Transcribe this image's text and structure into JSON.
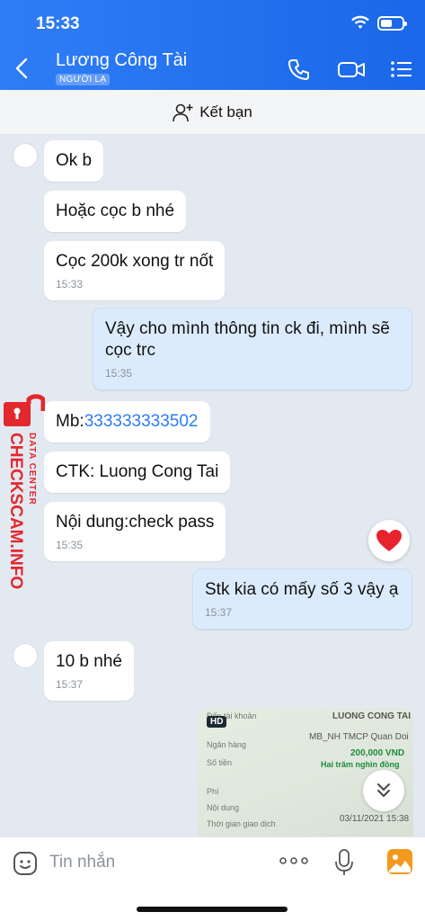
{
  "status_bar": {
    "time": "15:33"
  },
  "header": {
    "contact_name": "Lương Công Tài",
    "badge": "NGƯỜI LẠ"
  },
  "add_friend": {
    "label": "Kết bạn"
  },
  "messages": [
    {
      "dir": "in",
      "text": "Ok b"
    },
    {
      "dir": "in",
      "text": "Hoặc cọc b nhé"
    },
    {
      "dir": "in",
      "text": "Cọc 200k xong tr nốt",
      "time": "15:33"
    },
    {
      "dir": "out",
      "line1": "Vậy cho mình thông tin ck đi, mình sẽ",
      "line2": "cọc trc",
      "time": "15:35"
    },
    {
      "dir": "in",
      "prefix": "Mb:",
      "link": "333333333502"
    },
    {
      "dir": "in",
      "text": "CTK: Luong Cong Tai"
    },
    {
      "dir": "in",
      "text": "Nội dung:check pass",
      "time": "15:35"
    },
    {
      "dir": "out",
      "text": "Stk kia có mấy số 3 vậy ạ",
      "time": "15:37"
    },
    {
      "dir": "in",
      "text": "10 b nhé",
      "time": "15:37"
    }
  ],
  "image_message": {
    "badge": "HD",
    "labels": [
      "Đến tài khoản",
      "Ngân hàng",
      "Số tiền",
      "Phí",
      "Nội dung",
      "Thời gian giao dịch"
    ],
    "values": [
      "LUONG CONG TAI",
      "MB_NH TMCP Quan Doi",
      "200,000 VND",
      "Hai trăm nghìn đồng",
      "03/11/2021 15:38"
    ]
  },
  "watermark": {
    "brand": "CHECKSCAM.INFO",
    "sub": "DATA CENTER",
    "color": "#e3282d"
  },
  "composer": {
    "placeholder": "Tin nhắn"
  },
  "colors": {
    "header": "#1a67e9",
    "link": "#2d7cf5",
    "outgoing_bubble": "#dcebfb"
  }
}
